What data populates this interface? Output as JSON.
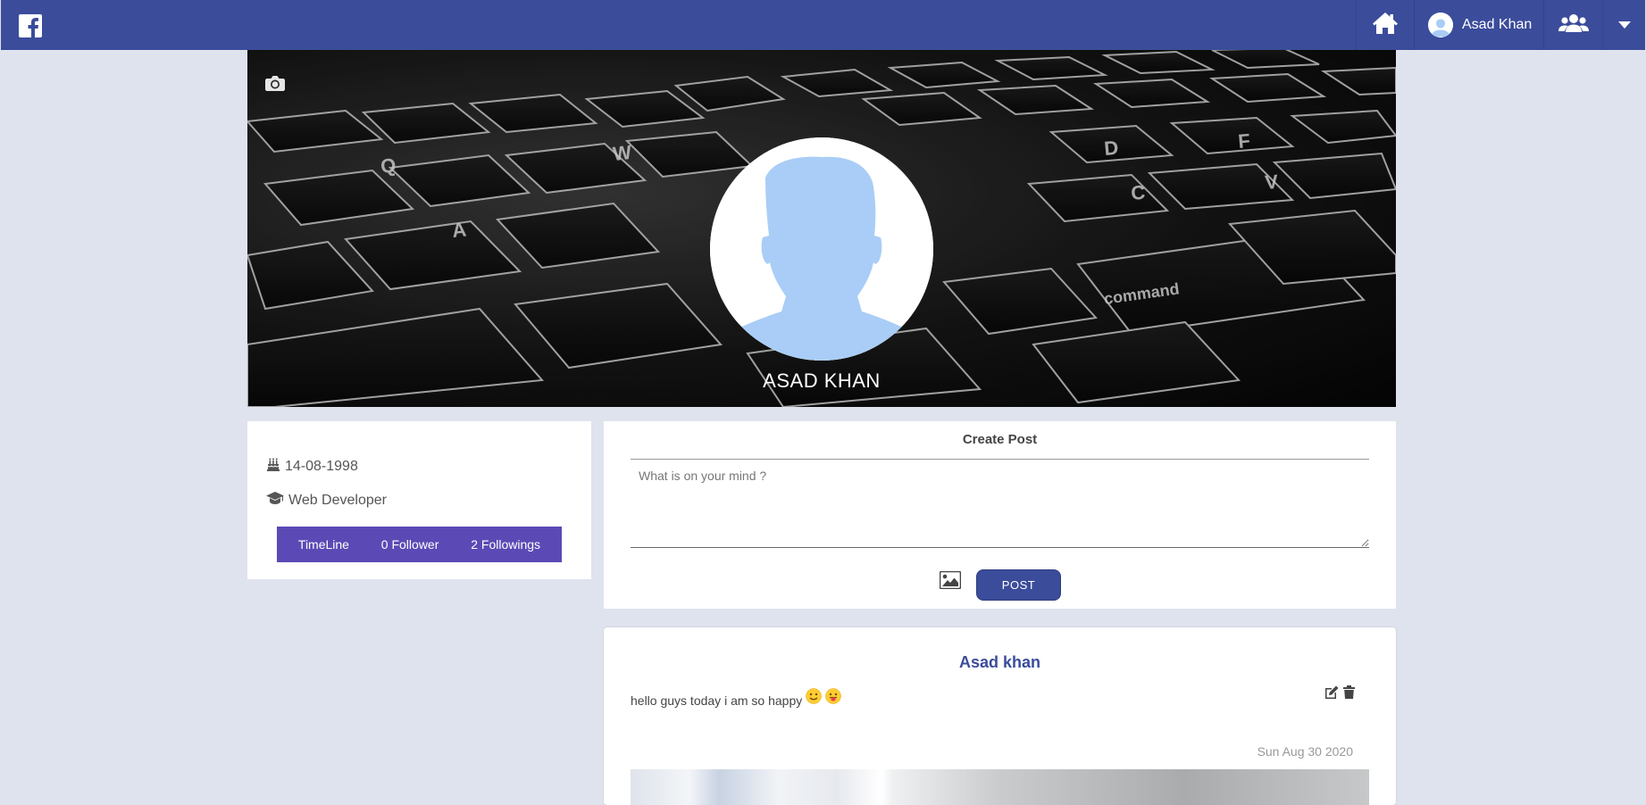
{
  "navbar": {
    "logo_icon": "facebook-logo-icon",
    "home_icon": "home-icon",
    "user_name": "Asad Khan",
    "friends_icon": "friends-icon",
    "menu_icon": "caret-down-icon",
    "bg_color": "#3b4c9b"
  },
  "cover": {
    "camera_icon": "camera-icon",
    "profile_name": "ASAD KHAN"
  },
  "profile_info": {
    "birthday_icon": "birthday-cake-icon",
    "birthday": "14-08-1998",
    "job_icon": "graduation-cap-icon",
    "occupation": "Web Developer",
    "tabs": [
      "TimeLine",
      "0 Follower",
      "2 Followings"
    ],
    "tabs_color": "#5b4ab5"
  },
  "create_post": {
    "title": "Create Post",
    "placeholder": "What is on your mind ?",
    "image_icon": "image-icon",
    "post_button": "POST"
  },
  "post": {
    "author": "Asad khan",
    "text": "hello guys today i am so happy",
    "emojis": [
      "slightly-smiling-emoji",
      "tongue-out-emoji"
    ],
    "edit_icon": "edit-icon",
    "delete_icon": "trash-icon",
    "date": "Sun Aug 30 2020"
  }
}
